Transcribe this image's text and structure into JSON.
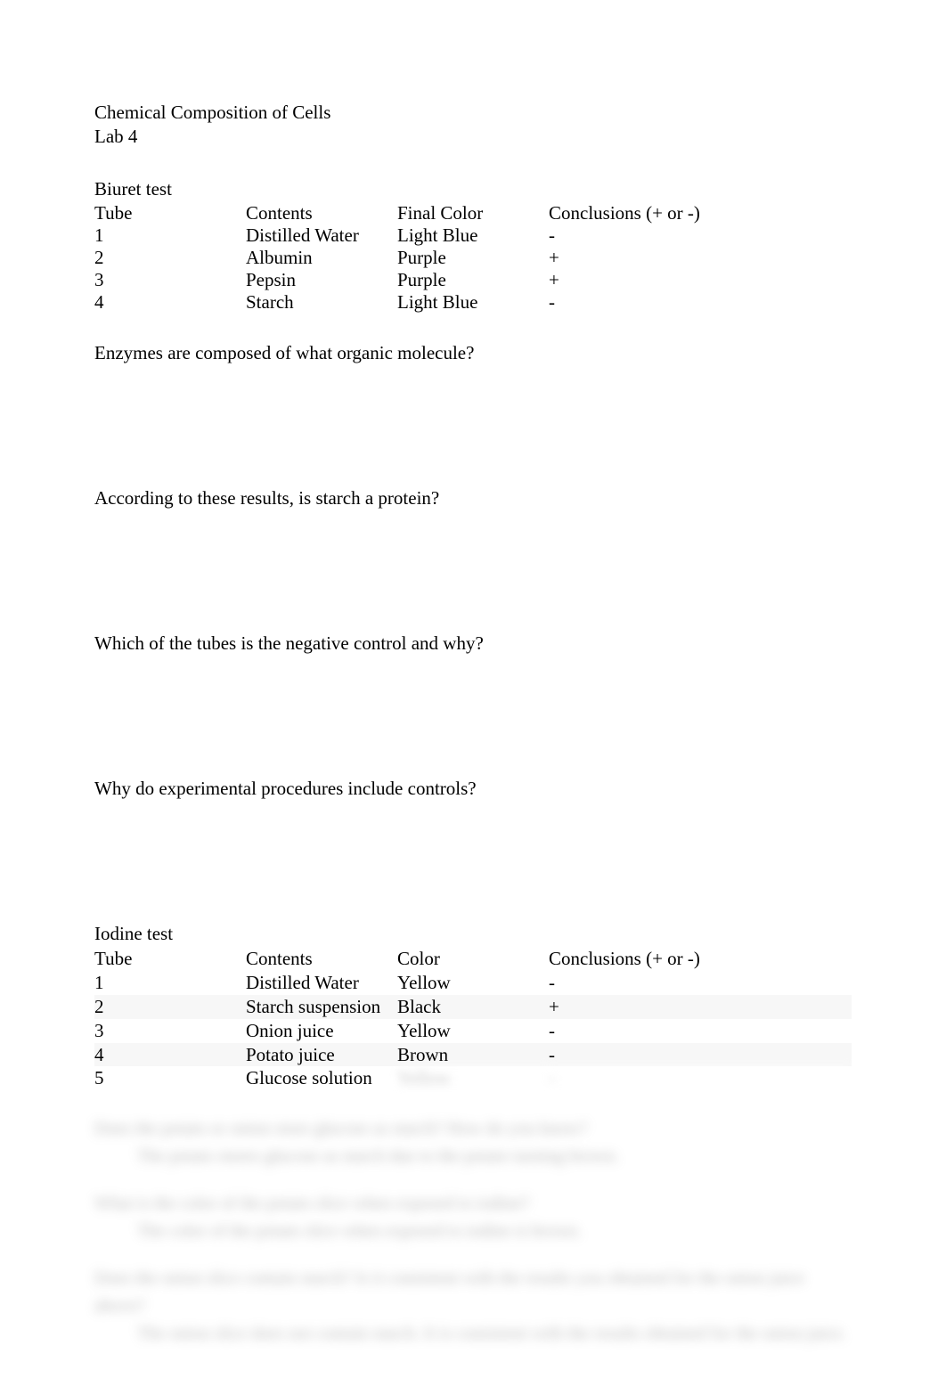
{
  "header": {
    "title": "Chemical Composition of Cells",
    "subtitle": "Lab 4"
  },
  "biuret": {
    "heading": "Biuret test",
    "columns": [
      "Tube",
      "Contents",
      "Final Color",
      "Conclusions (+ or -)"
    ],
    "rows": [
      {
        "tube": "1",
        "contents": "Distilled Water",
        "color": "Light Blue",
        "conclusion": "-"
      },
      {
        "tube": "2",
        "contents": "Albumin",
        "color": "Purple",
        "conclusion": "+"
      },
      {
        "tube": "3",
        "contents": "Pepsin",
        "color": "Purple",
        "conclusion": "+"
      },
      {
        "tube": "4",
        "contents": "Starch",
        "color": "Light Blue",
        "conclusion": "-"
      }
    ]
  },
  "questions": {
    "q1": "Enzymes are composed of what organic molecule?",
    "q2": "According to these results, is starch a protein?",
    "q3": "Which of the tubes is the negative control and why?",
    "q4": "Why do experimental procedures include controls?"
  },
  "iodine": {
    "heading": "Iodine test",
    "columns": [
      "Tube",
      "Contents",
      "Color",
      "Conclusions (+ or -)"
    ],
    "rows": [
      {
        "tube": "1",
        "contents": "Distilled Water",
        "color": "Yellow",
        "conclusion": "-"
      },
      {
        "tube": "2",
        "contents": "Starch suspension",
        "color": "Black",
        "conclusion": "+"
      },
      {
        "tube": "3",
        "contents": "Onion juice",
        "color": "Yellow",
        "conclusion": "-"
      },
      {
        "tube": "4",
        "contents": "Potato juice",
        "color": "Brown",
        "conclusion": "-"
      },
      {
        "tube": "5",
        "contents": "Glucose solution",
        "color": "Yellow",
        "conclusion": "-"
      }
    ]
  },
  "blurred": {
    "q1": "Does the potato or onion store glucose as starch? How do you know?",
    "a1": "The potato stores glucose as starch due to the potato turning brown.",
    "q2": "What is the color of the potato slice when exposed to iodine?",
    "a2": "The color of the potato slice when exposed to iodine is brown.",
    "q3": "Does the onion slice contain starch? Is it consistent with the results you obtained for the onion juice above?",
    "a3": "The onion slice does not contain starch. It is consistent with the results obtained for the onion juice."
  }
}
